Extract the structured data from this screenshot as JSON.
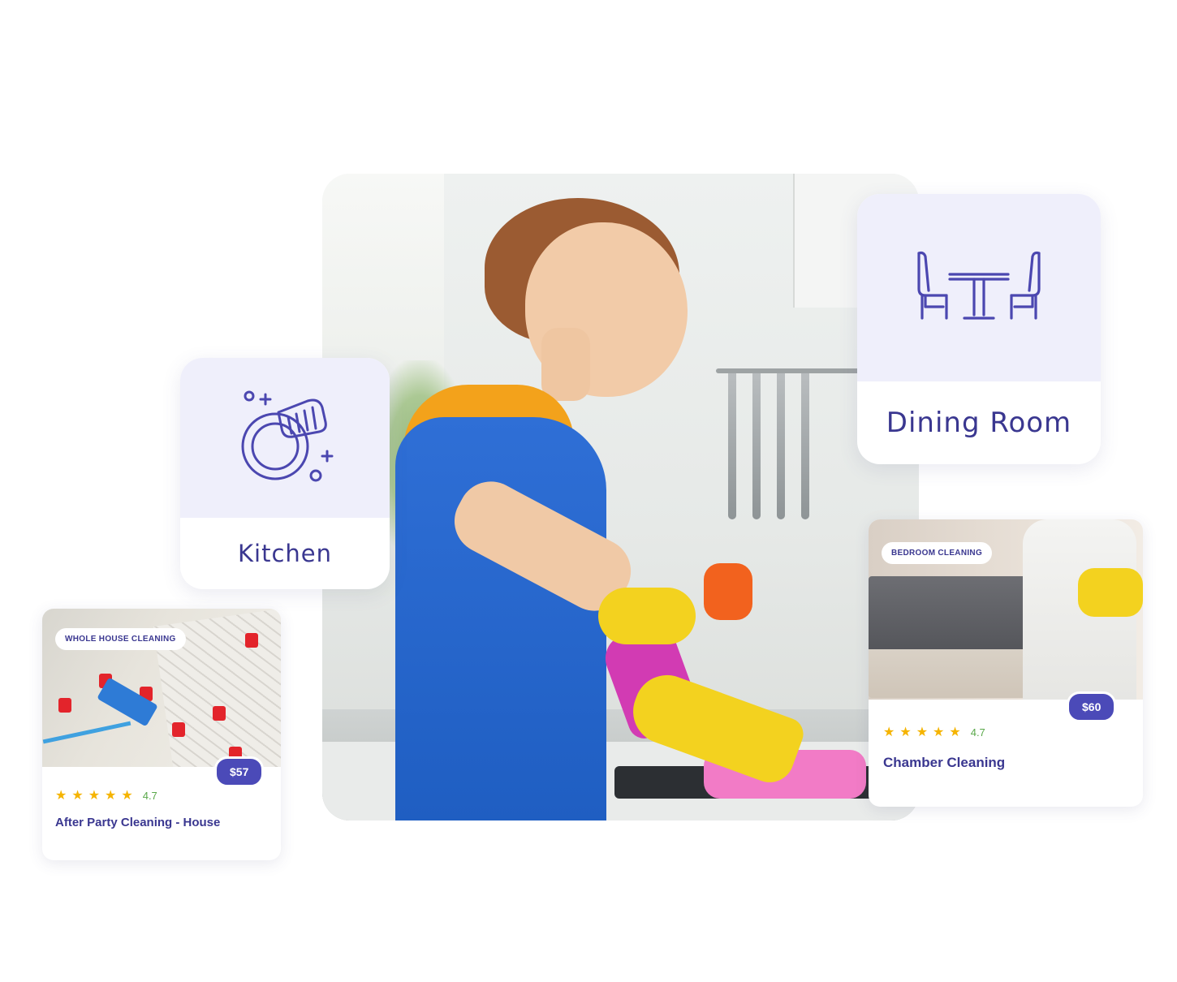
{
  "tiles": {
    "kitchen": {
      "label": "Kitchen",
      "icon": "dish-cleaning-icon"
    },
    "dining": {
      "label": "Dining Room",
      "icon": "dining-table-icon"
    }
  },
  "cards": {
    "party": {
      "tag": "WHOLE HOUSE CLEANING",
      "price": "$57",
      "rating": "4.7",
      "stars": 5,
      "title": "After Party Cleaning - House"
    },
    "bedroom": {
      "tag": "BEDROOM CLEANING",
      "price": "$60",
      "rating": "4.7",
      "stars": 5,
      "title": "Chamber Cleaning"
    }
  },
  "colors": {
    "brand": "#3a3790",
    "price_badge": "#4b4ab8",
    "icon_tile_bg": "#efeffb",
    "star": "#f5b400",
    "rating_text": "#5aa84a"
  }
}
